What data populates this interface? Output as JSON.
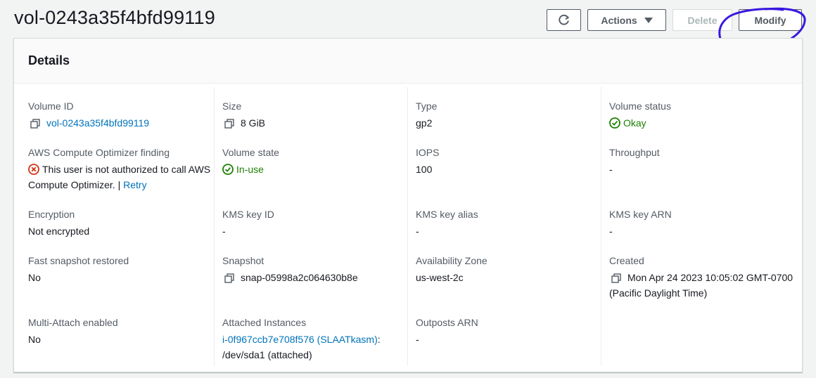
{
  "header": {
    "title": "vol-0243a35f4bfd99119",
    "actions_label": "Actions",
    "delete_label": "Delete",
    "modify_label": "Modify"
  },
  "details": {
    "title": "Details",
    "volume_id": {
      "label": "Volume ID",
      "value": "vol-0243a35f4bfd99119"
    },
    "size": {
      "label": "Size",
      "value": "8 GiB"
    },
    "type": {
      "label": "Type",
      "value": "gp2"
    },
    "volume_status": {
      "label": "Volume status",
      "value": "Okay"
    },
    "optimizer": {
      "label": "AWS Compute Optimizer finding",
      "message": "This user is not authorized to call AWS Compute Optimizer.",
      "separator": "|",
      "retry_label": "Retry"
    },
    "volume_state": {
      "label": "Volume state",
      "value": "In-use"
    },
    "iops": {
      "label": "IOPS",
      "value": "100"
    },
    "throughput": {
      "label": "Throughput",
      "value": "-"
    },
    "encryption": {
      "label": "Encryption",
      "value": "Not encrypted"
    },
    "kms_key_id": {
      "label": "KMS key ID",
      "value": "-"
    },
    "kms_key_alias": {
      "label": "KMS key alias",
      "value": "-"
    },
    "kms_key_arn": {
      "label": "KMS key ARN",
      "value": "-"
    },
    "fast_snapshot": {
      "label": "Fast snapshot restored",
      "value": "No"
    },
    "snapshot": {
      "label": "Snapshot",
      "value": "snap-05998a2c064630b8e"
    },
    "availability_zone": {
      "label": "Availability Zone",
      "value": "us-west-2c"
    },
    "created": {
      "label": "Created",
      "value": "Mon Apr 24 2023 10:05:02 GMT-0700 (Pacific Daylight Time)"
    },
    "multi_attach": {
      "label": "Multi-Attach enabled",
      "value": "No"
    },
    "attached_instances": {
      "label": "Attached Instances",
      "instance_link": "i-0f967ccb7e708f576 (SLAATkasm)",
      "suffix": ": /dev/sda1 (attached)"
    },
    "outposts_arn": {
      "label": "Outposts ARN",
      "value": "-"
    }
  },
  "colors": {
    "link": "#0073bb",
    "success": "#1d8102",
    "error": "#d13212",
    "annotation": "#3a17e0"
  }
}
